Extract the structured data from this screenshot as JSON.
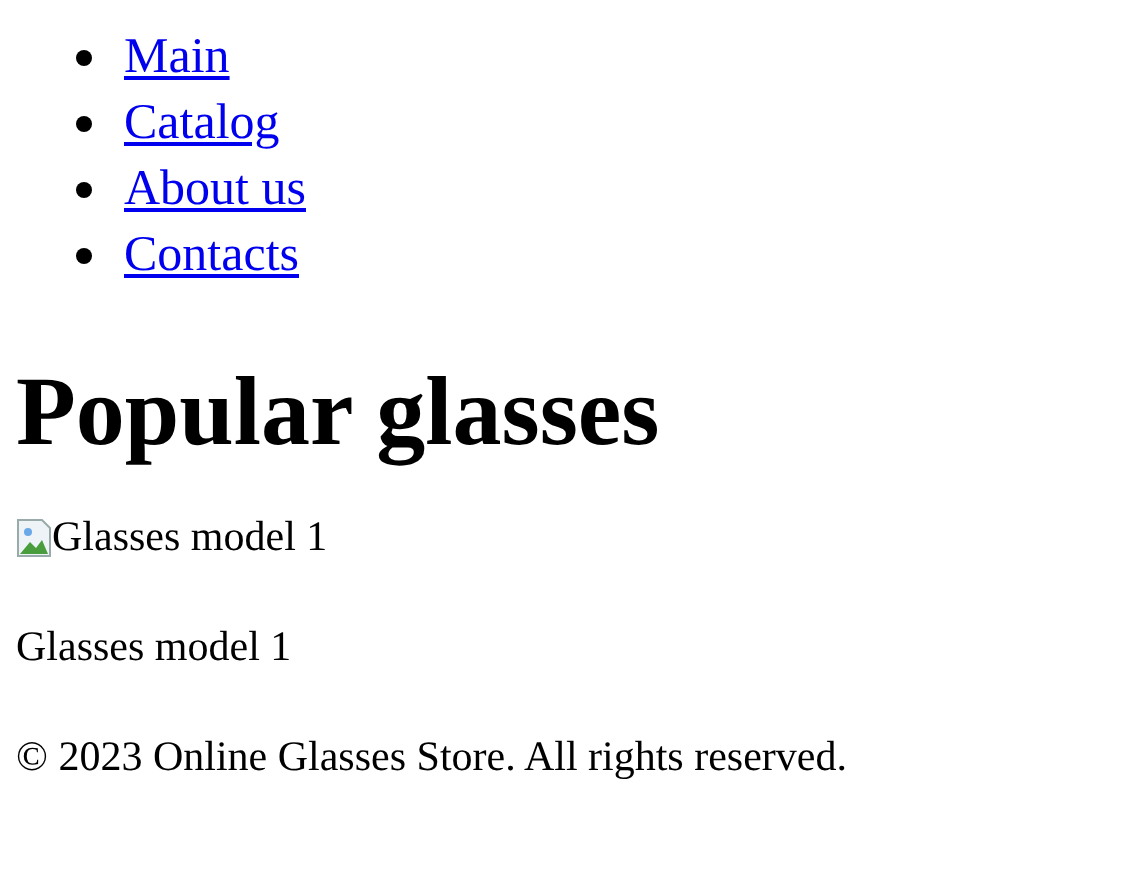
{
  "nav": {
    "items": [
      {
        "label": "Main"
      },
      {
        "label": "Catalog"
      },
      {
        "label": "About us"
      },
      {
        "label": "Contacts"
      }
    ]
  },
  "heading": "Popular glasses",
  "products": [
    {
      "image_alt": "Glasses model 1",
      "name": "Glasses model 1"
    }
  ],
  "footer": "© 2023 Online Glasses Store. All rights reserved."
}
